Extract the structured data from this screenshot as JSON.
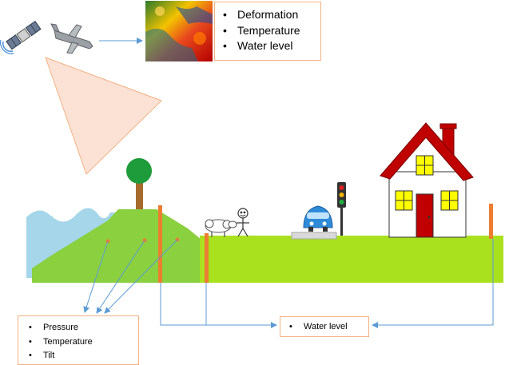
{
  "satellite_box": {
    "items": [
      "Deformation",
      "Temperature",
      "Water level"
    ]
  },
  "ground_box": {
    "items": [
      "Pressure",
      "Temperature",
      "Tilt"
    ]
  },
  "water_box": {
    "items": [
      "Water level"
    ]
  },
  "colors": {
    "grass": "#a9e11f",
    "dam": "#8ad03f",
    "water": "#a5d6ea",
    "sensor_pole": "#ed7d31",
    "arrow": "#5b9bd5",
    "box_border": "#f4b183",
    "beam": "#fbe2d5",
    "house_roof": "#c00000",
    "window": "#ffff00"
  },
  "icons": [
    "satellite-icon",
    "aircraft-icon",
    "satellite-image-map",
    "tree-icon",
    "sheep-icon",
    "stick-figure-person",
    "car-icon",
    "traffic-light-icon",
    "house-icon"
  ]
}
